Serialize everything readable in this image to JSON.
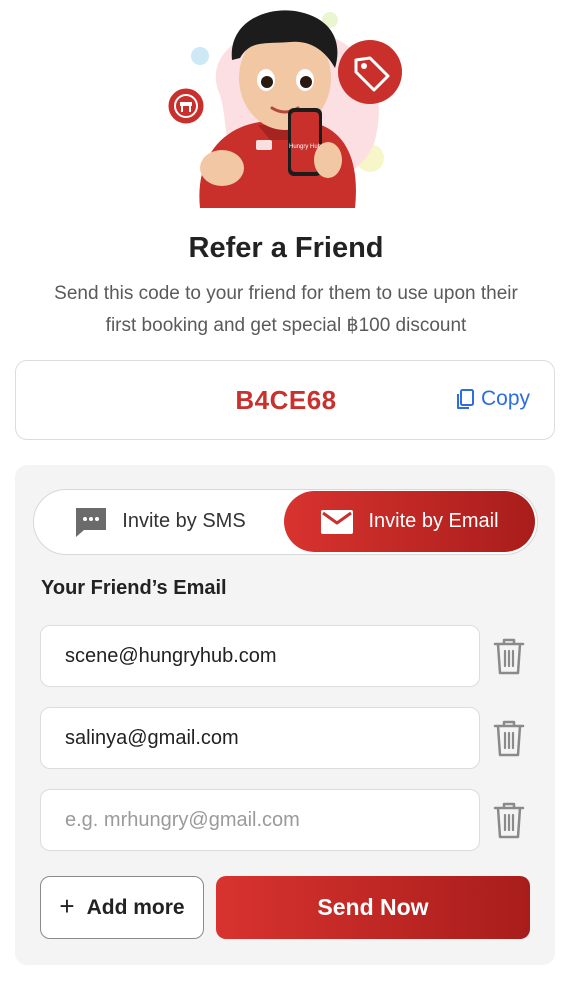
{
  "header": {
    "title": "Refer a Friend",
    "subtitle_line1": "Send this code to your friend for them to use upon their",
    "subtitle_line2": "first booking and get special ฿100 discount"
  },
  "referral": {
    "code": "B4CE68",
    "copy_label": "Copy"
  },
  "invite_tabs": [
    {
      "label": "Invite by SMS",
      "icon": "chat-icon",
      "active": false
    },
    {
      "label": "Invite by Email",
      "icon": "mail-icon",
      "active": true
    }
  ],
  "email_form": {
    "label": "Your Friend’s Email",
    "fields": [
      {
        "value": "scene@hungryhub.com",
        "placeholder": ""
      },
      {
        "value": "salinya@gmail.com",
        "placeholder": ""
      },
      {
        "value": "",
        "placeholder": "e.g. mrhungry@gmail.com"
      }
    ],
    "add_more_label": "Add more",
    "send_label": "Send Now"
  },
  "colors": {
    "brand_red": "#c8312d",
    "link_blue": "#2e6ce0",
    "panel_bg": "#f4f4f4"
  },
  "illustration": {
    "icon": "mascot-with-phone-illustration",
    "phone_text": "Hungry Hub"
  }
}
